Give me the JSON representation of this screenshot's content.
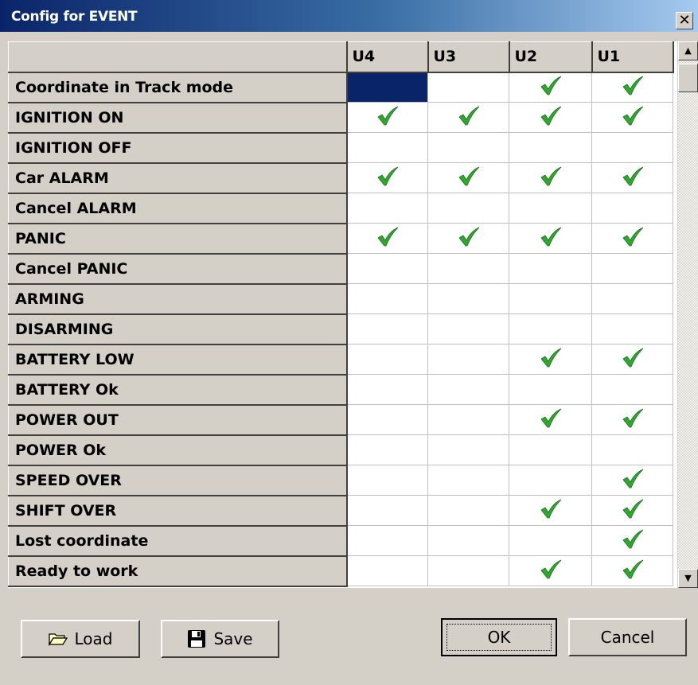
{
  "window": {
    "title": "Config for EVENT",
    "close_glyph": "✕"
  },
  "grid": {
    "columns": [
      "",
      "U4",
      "U3",
      "U2",
      "U1"
    ],
    "rows": [
      {
        "label": "Coordinate in Track mode",
        "checks": [
          false,
          false,
          true,
          true
        ],
        "selected": 0
      },
      {
        "label": "IGNITION ON",
        "checks": [
          true,
          true,
          true,
          true
        ]
      },
      {
        "label": "IGNITION OFF",
        "checks": [
          false,
          false,
          false,
          false
        ]
      },
      {
        "label": "Car ALARM",
        "checks": [
          true,
          true,
          true,
          true
        ]
      },
      {
        "label": "Cancel ALARM",
        "checks": [
          false,
          false,
          false,
          false
        ]
      },
      {
        "label": "PANIC",
        "checks": [
          true,
          true,
          true,
          true
        ]
      },
      {
        "label": "Cancel PANIC",
        "checks": [
          false,
          false,
          false,
          false
        ]
      },
      {
        "label": "ARMING",
        "checks": [
          false,
          false,
          false,
          false
        ]
      },
      {
        "label": "DISARMING",
        "checks": [
          false,
          false,
          false,
          false
        ]
      },
      {
        "label": "BATTERY LOW",
        "checks": [
          false,
          false,
          true,
          true
        ]
      },
      {
        "label": "BATTERY Ok",
        "checks": [
          false,
          false,
          false,
          false
        ]
      },
      {
        "label": "POWER OUT",
        "checks": [
          false,
          false,
          true,
          true
        ]
      },
      {
        "label": "POWER Ok",
        "checks": [
          false,
          false,
          false,
          false
        ]
      },
      {
        "label": "SPEED OVER",
        "checks": [
          false,
          false,
          false,
          true
        ]
      },
      {
        "label": "SHIFT OVER",
        "checks": [
          false,
          false,
          true,
          true
        ]
      },
      {
        "label": "Lost coordinate",
        "checks": [
          false,
          false,
          false,
          true
        ]
      },
      {
        "label": "Ready to work",
        "checks": [
          false,
          false,
          true,
          true
        ]
      }
    ],
    "check_icon": "checkmark-icon",
    "check_color": "#2ea82e",
    "selected_color": "#0a246a"
  },
  "scrollbar": {
    "up_glyph": "▲",
    "down_glyph": "▼"
  },
  "buttons": {
    "load": {
      "label": "Load",
      "icon": "folder-icon"
    },
    "save": {
      "label": "Save",
      "icon": "floppy-disk-icon"
    },
    "ok": {
      "label": "OK"
    },
    "cancel": {
      "label": "Cancel"
    }
  }
}
